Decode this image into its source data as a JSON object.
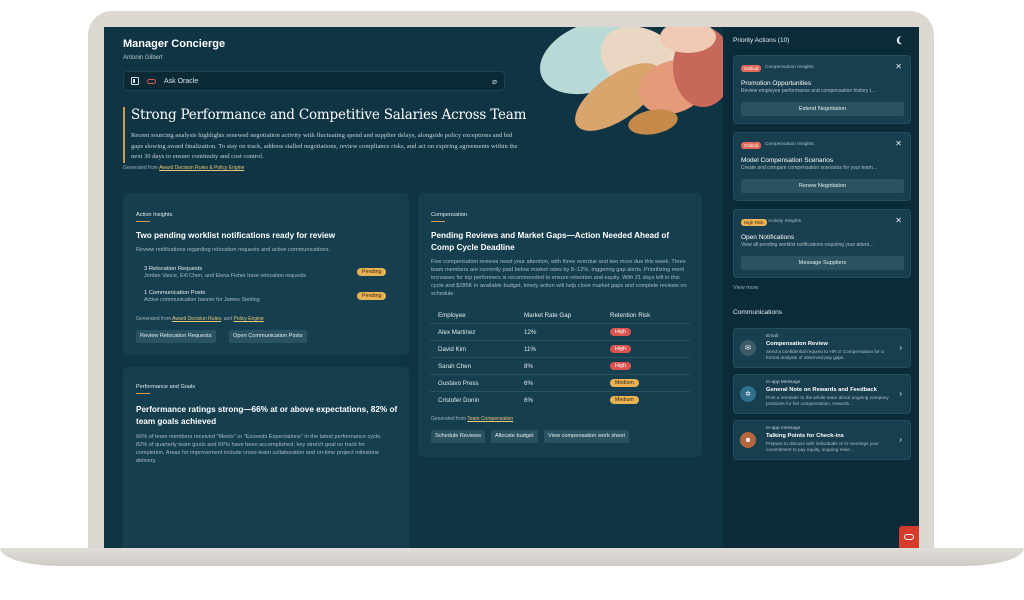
{
  "app": {
    "title": "Manager Concierge",
    "user": "Antonin Gilbert"
  },
  "ask": {
    "text": "Ask Oracle"
  },
  "hero": {
    "title": "Strong Performance and Competitive Salaries Across Team",
    "body": "Recent sourcing analysis highlights renewed negotiation activity with fluctuating spend and supplier delays, alongside policy exceptions and bid gaps slowing award finalization. To stay on track, address stalled negotiations, review compliance risks, and act on expiring agreements within the next 30 days to ensure continuity and cost control.",
    "gen_prefix": "Generated from ",
    "gen_link": "Award Decision Rules & Policy Engine"
  },
  "action_insights": {
    "label": "Action Insights",
    "title": "Two pending worklist notifications ready for review",
    "sub": "Review notifications regarding relocation requests and active communications.",
    "items": [
      {
        "title": "3 Relocation Requests",
        "sub": "Jordan Vance, Erll Chen, and Elena Fisher have relocation requests",
        "status": "Pending"
      },
      {
        "title": "1 Communication Posts",
        "sub": "Active communication banner for James Sterling",
        "status": "Pending"
      }
    ],
    "gen_prefix": "Generated from ",
    "gen_link1": "Award Decision Rules",
    "gen_and": ", and ",
    "gen_link2": "Policy Engine",
    "buttons": [
      "Review Relocation Requests",
      "Open Communication Posts"
    ]
  },
  "performance": {
    "label": "Performance and Goals",
    "title": "Performance ratings strong—66% at or above expectations, 82% of team goals achieved",
    "body": "66% of team members received \"Meets\" or \"Exceeds Expectations\" in the latest performance cycle. 82% of quarterly team goals and KPIs have been accomplished; key stretch goal on track for completion. Areas for improvement include cross-team collaboration and on-time project milestone delivery."
  },
  "compensation": {
    "label": "Compensation",
    "title": "Pending Reviews and Market Gaps—Action Needed Ahead of Comp Cycle Deadline",
    "body": "Five compensation reviews need your attention, with three overdue and two more due this week. Three team members are currently paid below market rates by 8–12%, triggering gap alerts. Prioritizing merit increases for top performers is recommended to ensure retention and equity. With 21 days left in this cycle and $285K in available budget, timely action will help close market gaps and complete reviews on schedule.",
    "columns": [
      "Employee",
      "Market Rate Gap",
      "Retention Risk"
    ],
    "rows": [
      {
        "name": "Alex Martinez",
        "gap": "12%",
        "risk": "High"
      },
      {
        "name": "David Kim",
        "gap": "11%",
        "risk": "High"
      },
      {
        "name": "Sarah Chen",
        "gap": "8%",
        "risk": "High"
      },
      {
        "name": "Gustavo Press",
        "gap": "6%",
        "risk": "Medium"
      },
      {
        "name": "Cristofer Donin",
        "gap": "6%",
        "risk": "Medium"
      }
    ],
    "gen_prefix": "Generated from ",
    "gen_link": "Team Compensation",
    "buttons": [
      "Schedule Reviews",
      "Allocate budget",
      "View compensation work sheet"
    ]
  },
  "priority": {
    "heading": "Priority Actions (10)",
    "cards": [
      {
        "tag": "Critical",
        "category": "Compensation Insights",
        "title": "Promotion Opportunities",
        "desc": "Review employee performance and compensation history t…",
        "button": "Extend Negotiation"
      },
      {
        "tag": "Critical",
        "category": "Compensation Insights",
        "title": "Model Compensation Scenarios",
        "desc": "Create and compare compensation scenarios for your team…",
        "button": "Renew Negotiation"
      },
      {
        "tag": "High Risk",
        "category": "Activity Insights",
        "title": "Open Notifications",
        "desc": "View all pending worklist notifications requiring your attent…",
        "button": "Message Suppliers"
      }
    ],
    "view_more": "View more"
  },
  "communications": {
    "heading": "Communications",
    "items": [
      {
        "type": "Email",
        "title": "Compensation Review",
        "desc": "Send a confidential request to HR or Compensation for a formal analysis of observed pay gaps.",
        "icon": "mail-icon",
        "color": "#3d5a66"
      },
      {
        "type": "In-app Message",
        "title": "General Note on Rewards and Feedback",
        "desc": "Post a reminder to the whole team about ongoing company practices for fair compensation, rewards…",
        "icon": "snowflake-icon",
        "color": "#2f6f8a"
      },
      {
        "type": "In-app message",
        "title": "Talking Points for Check-ins",
        "desc": "Prepare to discuss with individuals or in meetings your commitment to pay equity, ongoing revie…",
        "icon": "people-icon",
        "color": "#b5673c"
      }
    ]
  },
  "colors": {
    "background": "#0f3443",
    "card": "#153e4e",
    "accent": "#d59a52",
    "critical": "#e06a5a",
    "oracle_red": "#d33c2c"
  }
}
